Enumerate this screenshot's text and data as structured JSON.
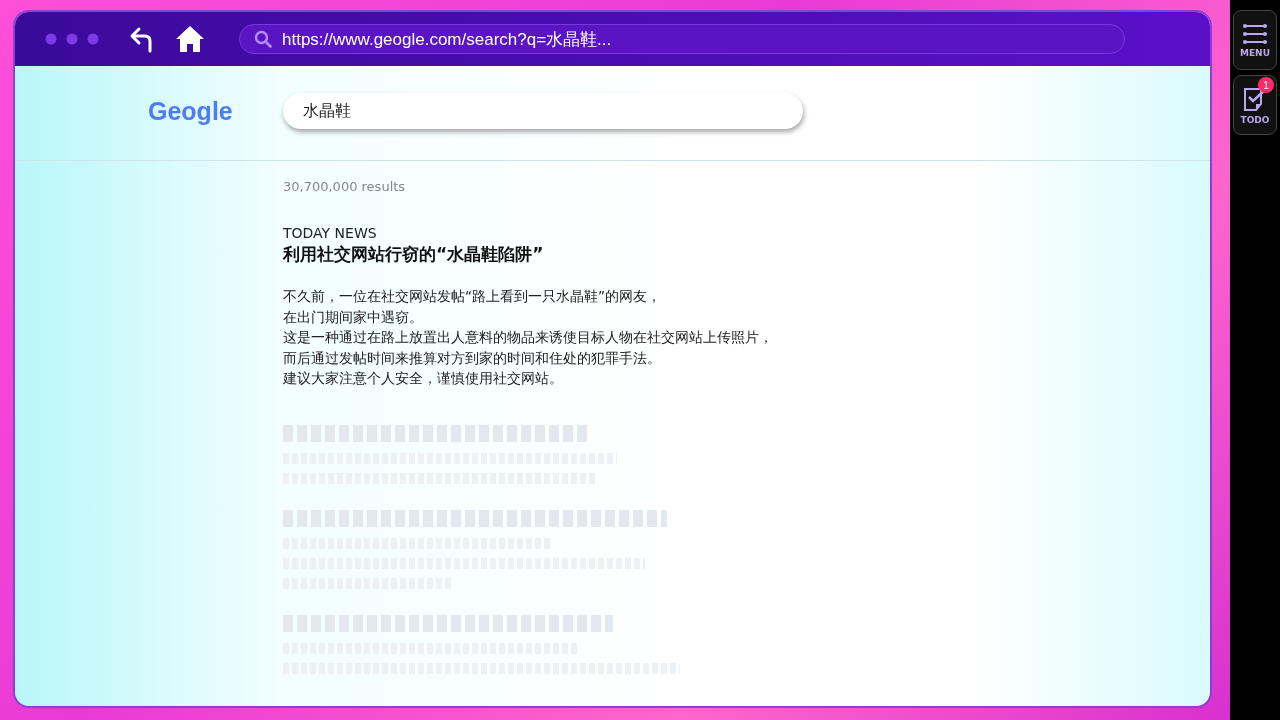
{
  "browser": {
    "url": "https://www.geogle.com/search?q=水晶鞋..."
  },
  "search_page": {
    "logo": "Geogle",
    "query": "水晶鞋",
    "result_count": "30,700,000 results"
  },
  "article": {
    "source": "TODAY NEWS",
    "headline": "利用社交网站行窃的“水晶鞋陷阱”",
    "body_lines": [
      "不久前，一位在社交网站发帖“路上看到一只水晶鞋”的网友，",
      "在出门期间家中遇窃。",
      "这是一种通过在路上放置出人意料的物品来诱使目标人物在社交网站上传照片，",
      "而后通过发帖时间来推算对方到家的时间和住处的犯罪手法。",
      "建议大家注意个人安全，谨慎使用社交网站。"
    ]
  },
  "side_menu": [
    {
      "kind": "menu",
      "label": "MENU"
    },
    {
      "kind": "todo",
      "label": "TODO",
      "badge": "1"
    }
  ]
}
